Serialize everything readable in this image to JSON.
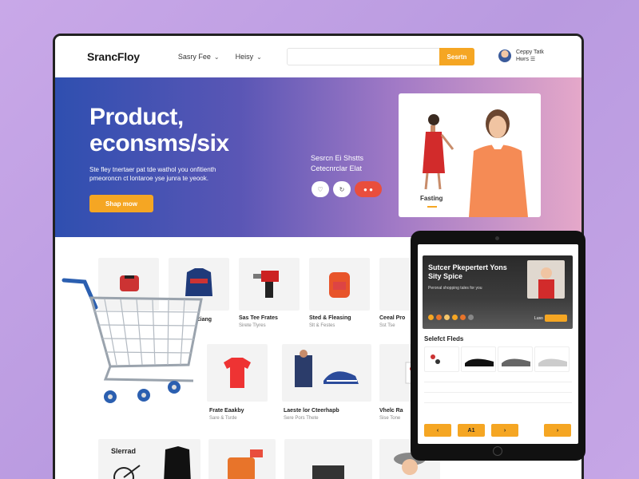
{
  "header": {
    "brand": "SrancFloy",
    "menu": [
      {
        "label": "Sasry Fee"
      },
      {
        "label": "Heisy"
      }
    ],
    "search": {
      "placeholder": "",
      "button_label": "Sesrtn"
    },
    "account": {
      "line1": "Ceppy   Tatk",
      "line2": "Hwrs     ☰"
    }
  },
  "hero": {
    "title_line1": "Product,",
    "title_line2": "econsms/six",
    "description_line1": "Ste fley tnertaer pat tde wathol you onfitienth",
    "description_line2": "pmeoroncn ct lontaroe yse junra te yeook.",
    "shop_button": "Shap mow",
    "middle_line1": "Sesrcn Ei Shstts",
    "middle_line2": "Cetecnrclar Elat",
    "card_label": "Fasting"
  },
  "products": [
    {
      "name": "Eiang",
      "sub": ""
    },
    {
      "name": "Sas Tee Frates",
      "sub": "Sirete Tlyres"
    },
    {
      "name": "Sted & Fleasing",
      "sub": "Slt & Festes"
    },
    {
      "name": "Ceeal Pro",
      "sub": "Sst Tse"
    },
    {
      "name": "Frate Eaakby",
      "sub": "Sare & Tsrde"
    },
    {
      "name": "Laeste lor Cteerhapb",
      "sub": "Sere Pors Thete"
    },
    {
      "name": "Vhelc Ra",
      "sub": "Sise Tone"
    },
    {
      "name": "Slerrad",
      "sub": ""
    }
  ],
  "tablet": {
    "banner_title": "Sutcer Pkepertert Yons Sity Spice",
    "banner_sub": "Peronal shopping tales for you",
    "buy_label": "Luso",
    "section_title": "Selefct Fleds",
    "buttons": [
      "‹",
      "A1",
      "›",
      "›"
    ]
  },
  "colors": {
    "accent": "#f5a623",
    "hero_gradient_start": "#2f4fb0",
    "hero_gradient_end": "#e5a8c9",
    "background": "#c9a8e8"
  }
}
